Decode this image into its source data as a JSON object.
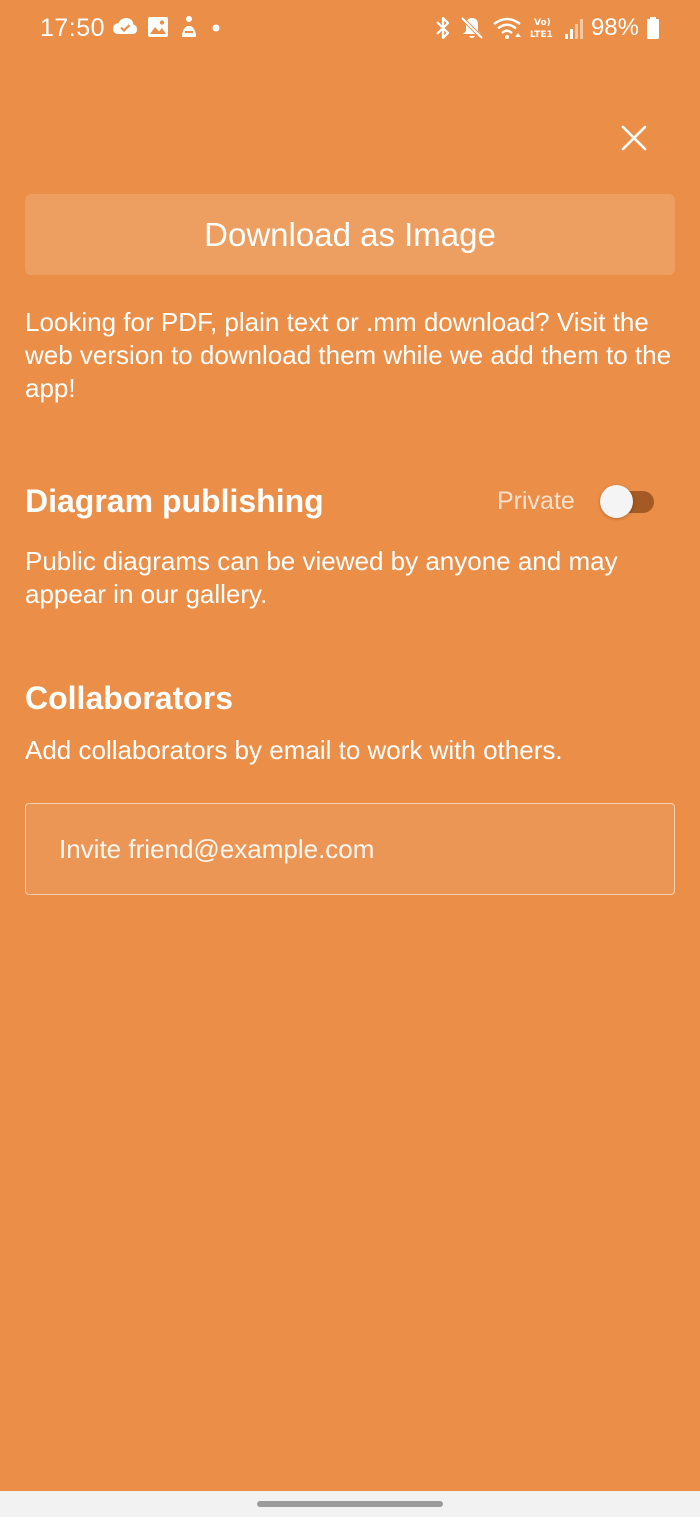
{
  "status_bar": {
    "time": "17:50",
    "battery": "98%"
  },
  "actions": {
    "download_image_label": "Download as Image"
  },
  "info": {
    "text": "Looking for PDF, plain text or .mm download? Visit the web version to download them while we add them to the app!"
  },
  "publishing": {
    "title": "Diagram publishing",
    "status_label": "Private",
    "is_public": false,
    "description": "Public diagrams can be viewed by anyone and may appear in our gallery."
  },
  "collaborators": {
    "title": "Collaborators",
    "description": "Add collaborators by email to work with others.",
    "invite_placeholder": "Invite friend@example.com"
  },
  "colors": {
    "background": "#eb8e47",
    "toggle_track": "#a55a24",
    "nav_bar": "#f2f2f2"
  }
}
